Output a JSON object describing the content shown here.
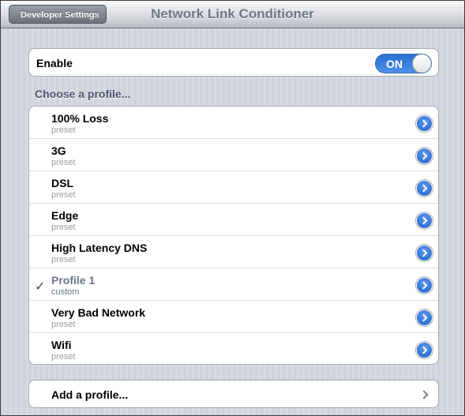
{
  "navbar": {
    "title": "Network Link Conditioner",
    "back_label": "Developer Settings"
  },
  "enable": {
    "label": "Enable",
    "toggle_label": "ON",
    "on": true
  },
  "profiles": {
    "header": "Choose a profile...",
    "items": [
      {
        "name": "100% Loss",
        "type": "preset",
        "selected": false
      },
      {
        "name": "3G",
        "type": "preset",
        "selected": false
      },
      {
        "name": "DSL",
        "type": "preset",
        "selected": false
      },
      {
        "name": "Edge",
        "type": "preset",
        "selected": false
      },
      {
        "name": "High Latency DNS",
        "type": "preset",
        "selected": false
      },
      {
        "name": "Profile 1",
        "type": "custom",
        "selected": true
      },
      {
        "name": "Very Bad Network",
        "type": "preset",
        "selected": false
      },
      {
        "name": "Wifi",
        "type": "preset",
        "selected": false
      }
    ],
    "check_glyph": "✓",
    "disclosure_icon": "blue-disclosure-chevron-icon"
  },
  "add_profile": {
    "label": "Add a profile...",
    "icon": "chevron-right-icon"
  },
  "colors": {
    "accent": "#2b6fd0",
    "selected_text": "#6a758a",
    "section_header": "#4c566c"
  }
}
